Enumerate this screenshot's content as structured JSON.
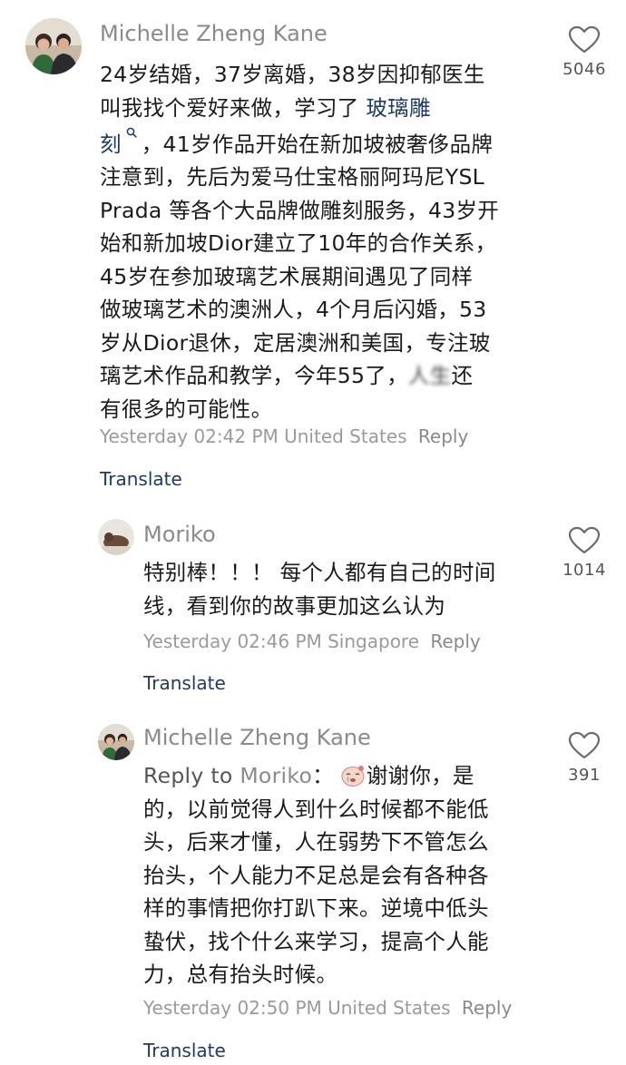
{
  "comments": [
    {
      "username": "Michelle Zheng Kane",
      "lines": [
        {
          "pre": "24岁结婚，37岁离婚，38岁因抑郁医生"
        },
        {
          "pre": "叫我找个爱好来做，学习了 ",
          "link": "玻璃雕"
        },
        {
          "link": "刻",
          "post": "，41岁作品开始在新加坡被奢侈品牌"
        },
        {
          "pre": "注意到，先后为爱马仕宝格丽阿玛尼YSL"
        },
        {
          "pre": "Prada 等各个大品牌做雕刻服务，43岁开"
        },
        {
          "pre": "始和新加坡Dior建立了10年的合作关系，"
        },
        {
          "pre": "45岁在参加玻璃艺术展期间遇见了同样"
        },
        {
          "pre": "做玻璃艺术的澳洲人，4个月后闪婚，53"
        },
        {
          "pre": "岁从Dior退休，定居澳洲和美国，专注玻"
        },
        {
          "pre": "璃艺术作品和教学，今年55了，",
          "blurred": "人生",
          "post": "还"
        },
        {
          "pre": "有很多的可能性。"
        }
      ],
      "search_glyph": "Q",
      "timestamp": "Yesterday 02:42 PM United States",
      "reply_label": "Reply",
      "translate_label": "Translate",
      "likes": "5046"
    },
    {
      "username": "Moriko",
      "lines": [
        {
          "pre": "特别棒！！！ 每个人都有自己的时间"
        },
        {
          "pre": "线，看到你的故事更加这么认为"
        }
      ],
      "timestamp": "Yesterday 02:46 PM Singapore",
      "reply_label": "Reply",
      "translate_label": "Translate",
      "likes": "1014"
    },
    {
      "username": "Michelle Zheng Kane",
      "reply_prefix": "Reply to ",
      "reply_target": "Moriko",
      "reply_colon": "：",
      "first_line_text": "谢谢你，是",
      "lines": [
        {
          "pre": "的，以前觉得人到什么时候都不能低"
        },
        {
          "pre": "头，后来才懂，人在弱势下不管怎么"
        },
        {
          "pre": "抬头，个人能力不足总是会有各种各"
        },
        {
          "pre": "样的事情把你打趴下来。逆境中低头"
        },
        {
          "pre": "蛰伏，找个什么来学习，提高个人能"
        },
        {
          "pre": "力，总有抬头时候。"
        }
      ],
      "timestamp": "Yesterday 02:50 PM United States",
      "reply_label": "Reply",
      "translate_label": "Translate",
      "likes": "391"
    }
  ],
  "icons": {
    "like": "heart-outline-icon",
    "emoji": "crying-face-emoji-icon",
    "search": "search-icon"
  },
  "colors": {
    "link": "#1f3a64",
    "meta": "#9a9a9a",
    "username": "#8a8a8a",
    "text": "#1b1b1b"
  }
}
